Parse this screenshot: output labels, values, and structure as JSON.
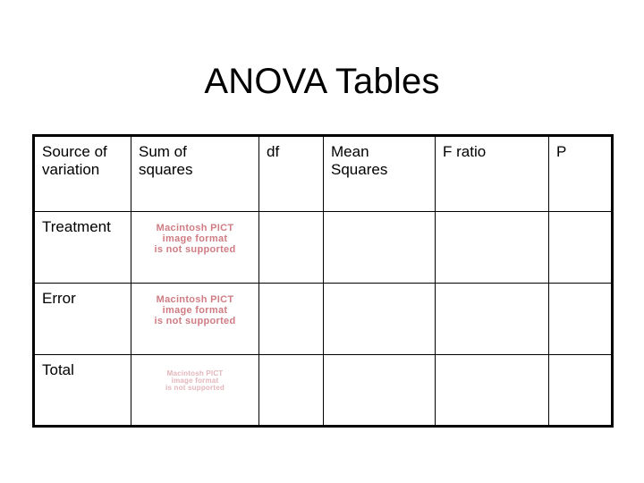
{
  "slide": {
    "title": "ANOVA Tables",
    "background_color": "#ffffff",
    "text_color": "#000000"
  },
  "table": {
    "border_color": "#000000",
    "columns": [
      {
        "key": "source",
        "header": "Source of\nvariation"
      },
      {
        "key": "ss",
        "header": "Sum of\nsquares"
      },
      {
        "key": "df",
        "header": "df"
      },
      {
        "key": "ms",
        "header": "Mean\nSquares"
      },
      {
        "key": "f",
        "header": "F ratio"
      },
      {
        "key": "p",
        "header": "P"
      }
    ],
    "rows": [
      {
        "source": "Treatment",
        "ss_placeholder": "macintosh-pict-unsupported",
        "ss_size": "normal",
        "df": "",
        "ms": "",
        "f": "",
        "p": ""
      },
      {
        "source": "Error",
        "ss_placeholder": "macintosh-pict-unsupported",
        "ss_size": "normal",
        "df": "",
        "ms": "",
        "f": "",
        "p": ""
      },
      {
        "source": "Total",
        "ss_placeholder": "macintosh-pict-unsupported",
        "ss_size": "small",
        "df": "",
        "ms": "",
        "f": "",
        "p": ""
      }
    ]
  },
  "pict_placeholder": {
    "text": "Macintosh PICT\nimage format\nis not supported",
    "line1": "Macintosh PICT",
    "line2": "image format",
    "line3": "is not supported",
    "color": "#cf7c83",
    "color_faded": "#e3b6ba"
  }
}
